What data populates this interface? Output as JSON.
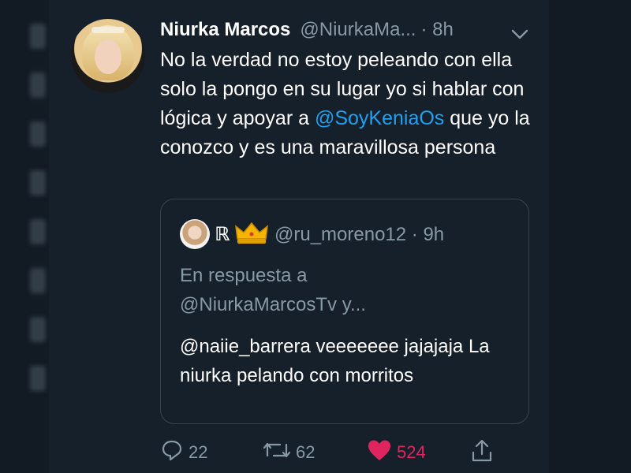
{
  "tweet": {
    "display_name": "Niurka Marcos",
    "handle": "@NiurkaMa...",
    "time": "· 8h",
    "text_before": "No la verdad no estoy peleando con ella solo la pongo en su lugar yo si hablar con lógica y apoyar a ",
    "mention": "@SoyKeniaOs",
    "text_after": " que yo la conozco y es una maravillosa persona"
  },
  "quoted": {
    "name": "ℝ",
    "handle_time": "@ru_moreno12 · 9h",
    "reply_line1": "En respuesta a",
    "reply_line2": "@NiurkaMarcosTv y...",
    "text": "@naiie_barrera  veeeeeee jajajaja La niurka pelando con morritos"
  },
  "actions": {
    "replies": "22",
    "retweets": "62",
    "likes": "524"
  },
  "colors": {
    "background": "#15202b",
    "mention": "#1da1f2",
    "muted": "#8899a6",
    "like": "#e0245e"
  },
  "icons": [
    "chevron-down-icon",
    "reply-icon",
    "retweet-icon",
    "heart-icon",
    "share-icon",
    "crown-icon"
  ]
}
